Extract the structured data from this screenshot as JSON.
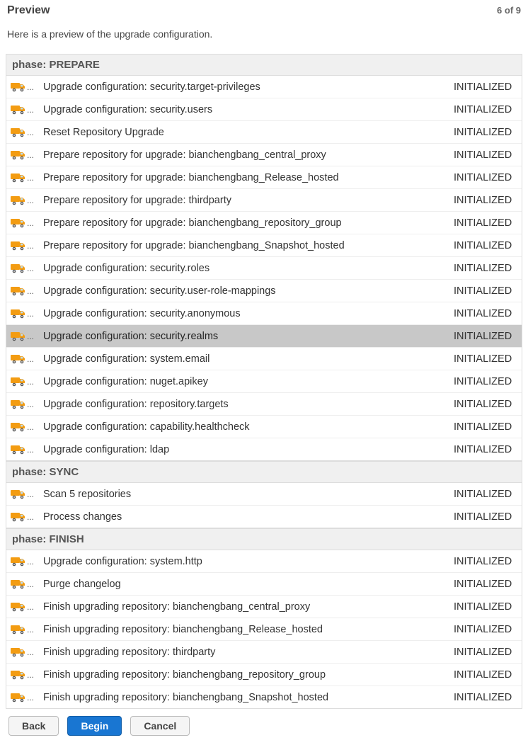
{
  "header": {
    "title": "Preview",
    "step": "6 of 9"
  },
  "intro": "Here is a preview of the upgrade configuration.",
  "phases": [
    {
      "label": "phase: PREPARE",
      "rows": [
        {
          "desc": "Upgrade configuration: security.target-privileges",
          "status": "INITIALIZED",
          "selected": false
        },
        {
          "desc": "Upgrade configuration: security.users",
          "status": "INITIALIZED",
          "selected": false
        },
        {
          "desc": "Reset Repository Upgrade",
          "status": "INITIALIZED",
          "selected": false
        },
        {
          "desc": "Prepare repository for upgrade: bianchengbang_central_proxy",
          "status": "INITIALIZED",
          "selected": false
        },
        {
          "desc": "Prepare repository for upgrade: bianchengbang_Release_hosted",
          "status": "INITIALIZED",
          "selected": false
        },
        {
          "desc": "Prepare repository for upgrade: thirdparty",
          "status": "INITIALIZED",
          "selected": false
        },
        {
          "desc": "Prepare repository for upgrade: bianchengbang_repository_group",
          "status": "INITIALIZED",
          "selected": false
        },
        {
          "desc": "Prepare repository for upgrade: bianchengbang_Snapshot_hosted",
          "status": "INITIALIZED",
          "selected": false
        },
        {
          "desc": "Upgrade configuration: security.roles",
          "status": "INITIALIZED",
          "selected": false
        },
        {
          "desc": "Upgrade configuration: security.user-role-mappings",
          "status": "INITIALIZED",
          "selected": false
        },
        {
          "desc": "Upgrade configuration: security.anonymous",
          "status": "INITIALIZED",
          "selected": false
        },
        {
          "desc": "Upgrade configuration: security.realms",
          "status": "INITIALIZED",
          "selected": true
        },
        {
          "desc": "Upgrade configuration: system.email",
          "status": "INITIALIZED",
          "selected": false
        },
        {
          "desc": "Upgrade configuration: nuget.apikey",
          "status": "INITIALIZED",
          "selected": false
        },
        {
          "desc": "Upgrade configuration: repository.targets",
          "status": "INITIALIZED",
          "selected": false
        },
        {
          "desc": "Upgrade configuration: capability.healthcheck",
          "status": "INITIALIZED",
          "selected": false
        },
        {
          "desc": "Upgrade configuration: ldap",
          "status": "INITIALIZED",
          "selected": false
        }
      ]
    },
    {
      "label": "phase: SYNC",
      "rows": [
        {
          "desc": "Scan 5 repositories",
          "status": "INITIALIZED",
          "selected": false
        },
        {
          "desc": "Process changes",
          "status": "INITIALIZED",
          "selected": false
        }
      ]
    },
    {
      "label": "phase: FINISH",
      "rows": [
        {
          "desc": "Upgrade configuration: system.http",
          "status": "INITIALIZED",
          "selected": false
        },
        {
          "desc": "Purge changelog",
          "status": "INITIALIZED",
          "selected": false
        },
        {
          "desc": "Finish upgrading repository: bianchengbang_central_proxy",
          "status": "INITIALIZED",
          "selected": false
        },
        {
          "desc": "Finish upgrading repository: bianchengbang_Release_hosted",
          "status": "INITIALIZED",
          "selected": false
        },
        {
          "desc": "Finish upgrading repository: thirdparty",
          "status": "INITIALIZED",
          "selected": false
        },
        {
          "desc": "Finish upgrading repository: bianchengbang_repository_group",
          "status": "INITIALIZED",
          "selected": false
        },
        {
          "desc": "Finish upgrading repository: bianchengbang_Snapshot_hosted",
          "status": "INITIALIZED",
          "selected": false
        }
      ]
    }
  ],
  "buttons": {
    "back": "Back",
    "begin": "Begin",
    "cancel": "Cancel"
  },
  "icons": {
    "truck": "truck-icon"
  }
}
